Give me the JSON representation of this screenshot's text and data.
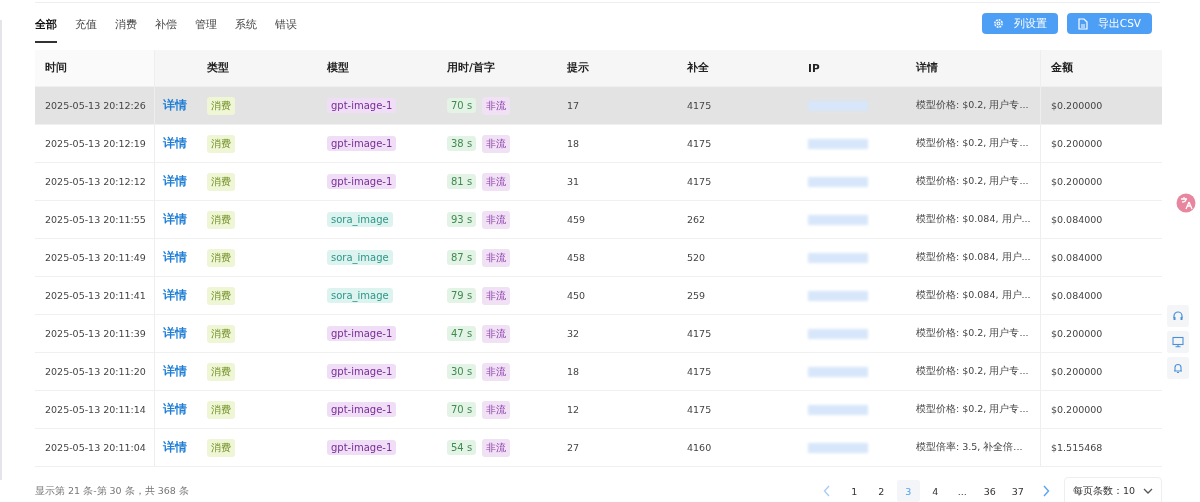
{
  "tabs": [
    {
      "label": "全部",
      "selected": true
    },
    {
      "label": "充值",
      "selected": false
    },
    {
      "label": "消费",
      "selected": false
    },
    {
      "label": "补偿",
      "selected": false
    },
    {
      "label": "管理",
      "selected": false
    },
    {
      "label": "系统",
      "selected": false
    },
    {
      "label": "错误",
      "selected": false
    }
  ],
  "toolbar": {
    "buttons": [
      {
        "label": "列设置",
        "kind": "settings"
      },
      {
        "label": "导出CSV",
        "kind": "export"
      }
    ]
  },
  "table": {
    "columns": [
      "时间",
      "",
      "类型",
      "模型",
      "用时/首字",
      "提示",
      "补全",
      "IP",
      "详情",
      "金额"
    ],
    "rows": [
      {
        "selected": true,
        "time": "2025-05-13 20:12:26",
        "link": "详情",
        "type": "消费",
        "model": "gpt-image-1",
        "color": "#efdef6",
        "duration": "70 s",
        "stream": "非流",
        "prompt": "17",
        "completion": "4175",
        "detail": "模型价格: $0.2, 用户专...",
        "amount": "$0.200000"
      },
      {
        "selected": false,
        "time": "2025-05-13 20:12:19",
        "link": "详情",
        "type": "消费",
        "model": "gpt-image-1",
        "color": "#efdef6",
        "duration": "38 s",
        "stream": "非流",
        "prompt": "18",
        "completion": "4175",
        "detail": "模型价格: $0.2, 用户专...",
        "amount": "$0.200000"
      },
      {
        "selected": false,
        "time": "2025-05-13 20:12:12",
        "link": "详情",
        "type": "消费",
        "model": "gpt-image-1",
        "color": "#efdef6",
        "duration": "81 s",
        "stream": "非流",
        "prompt": "31",
        "completion": "4175",
        "detail": "模型价格: $0.2, 用户专...",
        "amount": "$0.200000"
      },
      {
        "selected": false,
        "time": "2025-05-13 20:11:55",
        "link": "详情",
        "type": "消费",
        "model": "sora_image",
        "color": "#ddf3f0",
        "duration": "93 s",
        "stream": "非流",
        "prompt": "459",
        "completion": "262",
        "detail": "模型价格: $0.084, 用户...",
        "amount": "$0.084000"
      },
      {
        "selected": false,
        "time": "2025-05-13 20:11:49",
        "link": "详情",
        "type": "消费",
        "model": "sora_image",
        "color": "#ddf3f0",
        "duration": "87 s",
        "stream": "非流",
        "prompt": "458",
        "completion": "520",
        "detail": "模型价格: $0.084, 用户...",
        "amount": "$0.084000"
      },
      {
        "selected": false,
        "time": "2025-05-13 20:11:41",
        "link": "详情",
        "type": "消费",
        "model": "sora_image",
        "color": "#ddf3f0",
        "duration": "79 s",
        "stream": "非流",
        "prompt": "450",
        "completion": "259",
        "detail": "模型价格: $0.084, 用户...",
        "amount": "$0.084000"
      },
      {
        "selected": false,
        "time": "2025-05-13 20:11:39",
        "link": "详情",
        "type": "消费",
        "model": "gpt-image-1",
        "color": "#efdef6",
        "duration": "47 s",
        "stream": "非流",
        "prompt": "32",
        "completion": "4175",
        "detail": "模型价格: $0.2, 用户专...",
        "amount": "$0.200000"
      },
      {
        "selected": false,
        "time": "2025-05-13 20:11:20",
        "link": "详情",
        "type": "消费",
        "model": "gpt-image-1",
        "color": "#efdef6",
        "duration": "30 s",
        "stream": "非流",
        "prompt": "18",
        "completion": "4175",
        "detail": "模型价格: $0.2, 用户专...",
        "amount": "$0.200000"
      },
      {
        "selected": false,
        "time": "2025-05-13 20:11:14",
        "link": "详情",
        "type": "消费",
        "model": "gpt-image-1",
        "color": "#efdef6",
        "duration": "70 s",
        "stream": "非流",
        "prompt": "12",
        "completion": "4175",
        "detail": "模型价格: $0.2, 用户专...",
        "amount": "$0.200000"
      },
      {
        "selected": false,
        "time": "2025-05-13 20:11:04",
        "link": "详情",
        "type": "消费",
        "model": "gpt-image-1",
        "color": "#efdef6",
        "duration": "54 s",
        "stream": "非流",
        "prompt": "27",
        "completion": "4160",
        "detail": "模型倍率: 3.5, 补全倍...",
        "amount": "$1.515468"
      }
    ]
  },
  "footer": {
    "summary": "显示第 21 条-第 30 条，共 368 条",
    "pages": [
      {
        "label": "1",
        "selected": false
      },
      {
        "label": "2",
        "selected": false
      },
      {
        "label": "3",
        "selected": true
      },
      {
        "label": "4",
        "selected": false
      },
      {
        "label": "...",
        "selected": false
      },
      {
        "label": "36",
        "selected": false
      },
      {
        "label": "37",
        "selected": false
      }
    ],
    "page_size": "每页条数：10"
  }
}
